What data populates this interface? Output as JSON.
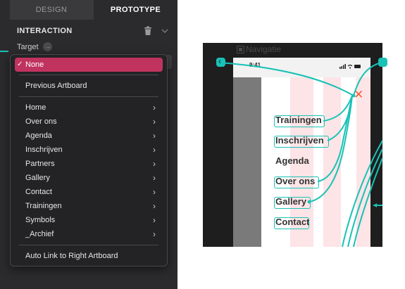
{
  "tabs": {
    "design": "DESIGN",
    "prototype": "PROTOTYPE"
  },
  "interaction": {
    "title": "INTERACTION",
    "target_label": "Target"
  },
  "menu": {
    "selected": "None",
    "previous": "Previous Artboard",
    "items": [
      "Home",
      "Over ons",
      "Agenda",
      "Inschrijven",
      "Partners",
      "Gallery",
      "Contact",
      "Trainingen",
      "Symbols",
      "_Archief"
    ],
    "auto_link": "Auto Link to Right Artboard"
  },
  "artboard": {
    "title": "Navigatie",
    "time": "9:41",
    "links": [
      "Trainingen",
      "Inschrijven",
      "Agenda",
      "Over ons",
      "Gallery",
      "Contact"
    ]
  },
  "colors": {
    "accent": "#c0335f",
    "link": "#19c2b6",
    "close": "#ff5a36"
  },
  "icons": [
    "trash-icon",
    "chevron-down-icon",
    "target-arrow-icon",
    "checkmark-icon",
    "chevron-right-icon",
    "artboard-icon",
    "close-icon"
  ]
}
